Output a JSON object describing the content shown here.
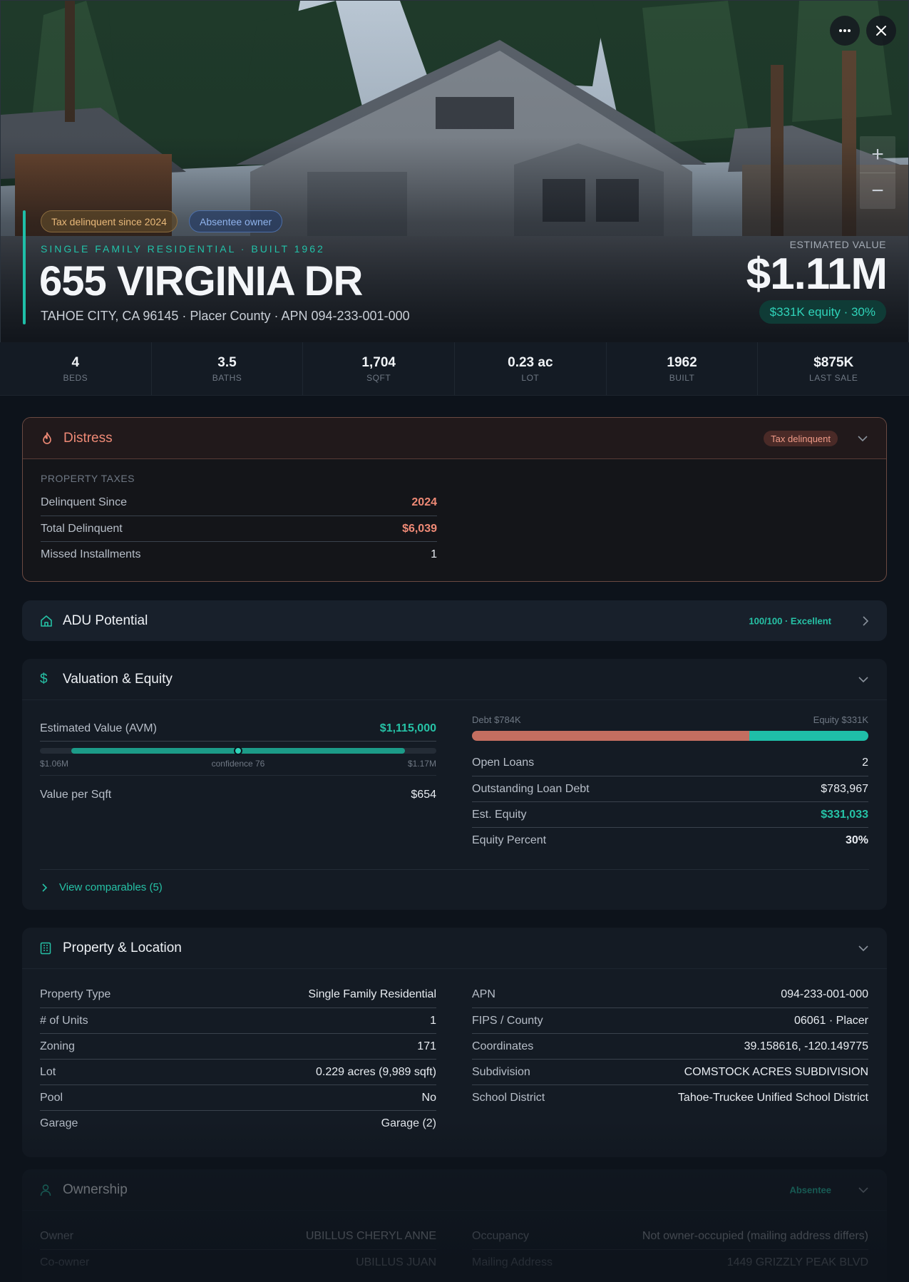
{
  "hero": {
    "badges": {
      "tax": "Tax delinquent since 2024",
      "absentee": "Absentee owner"
    },
    "subtitle": "SINGLE FAMILY RESIDENTIAL · BUILT 1962",
    "address": "655 VIRGINIA DR",
    "location": "TAHOE CITY, CA 96145 · Placer County · APN 094-233-001-000",
    "estimated_label": "ESTIMATED VALUE",
    "estimated_value": "$1.11M",
    "equity_badge": "$331K equity · 30%",
    "zoom_in": "+",
    "zoom_out": "−",
    "icons": {
      "more": "more-dots-icon",
      "close": "close-icon"
    }
  },
  "stats": [
    {
      "value": "4",
      "label": "BEDS"
    },
    {
      "value": "3.5",
      "label": "BATHS"
    },
    {
      "value": "1,704",
      "label": "SQFT"
    },
    {
      "value": "0.23 ac",
      "label": "LOT"
    },
    {
      "value": "1962",
      "label": "BUILT"
    },
    {
      "value": "$875K",
      "label": "LAST SALE"
    }
  ],
  "distress": {
    "title": "Distress",
    "badge": "Tax delinquent",
    "section_label": "PROPERTY TAXES",
    "rows": [
      {
        "label": "Delinquent Since",
        "value": "2024"
      },
      {
        "label": "Total Delinquent",
        "value": "$6,039"
      },
      {
        "label": "Missed Installments",
        "value": "1"
      }
    ]
  },
  "adu": {
    "title": "ADU Potential",
    "score": "100/100 · Excellent"
  },
  "valuation": {
    "title": "Valuation & Equity",
    "avm_label": "Estimated Value (AVM)",
    "avm_value": "$1,115,000",
    "range_low": "$1.06M",
    "range_high": "$1.17M",
    "confidence": "confidence 76",
    "range": {
      "low": 1060000,
      "high": 1170000,
      "estimate": 1115000
    },
    "value_per_sqft_label": "Value per Sqft",
    "value_per_sqft": "$654",
    "debt_label": "Debt $784K",
    "equity_label": "Equity $331K",
    "debt_fraction": 0.7,
    "rows": [
      {
        "label": "Open Loans",
        "value": "2"
      },
      {
        "label": "Outstanding Loan Debt",
        "value": "$783,967"
      },
      {
        "label": "Est. Equity",
        "value": "$331,033"
      },
      {
        "label": "Equity Percent",
        "value": "30%"
      }
    ],
    "comparables_link": "View comparables (5)"
  },
  "location": {
    "title": "Property & Location",
    "left": [
      {
        "label": "Property Type",
        "value": "Single Family Residential"
      },
      {
        "label": "# of Units",
        "value": "1"
      },
      {
        "label": "Zoning",
        "value": "171"
      },
      {
        "label": "Lot",
        "value": "0.229 acres (9,989 sqft)"
      },
      {
        "label": "Pool",
        "value": "No"
      },
      {
        "label": "Garage",
        "value": "Garage (2)"
      }
    ],
    "right": [
      {
        "label": "APN",
        "value": "094-233-001-000"
      },
      {
        "label": "FIPS / County",
        "value": "06061 · Placer"
      },
      {
        "label": "Coordinates",
        "value": "39.158616, -120.149775"
      },
      {
        "label": "Subdivision",
        "value": "COMSTOCK ACRES SUBDIVISION"
      },
      {
        "label": "School District",
        "value": "Tahoe-Truckee Unified School District"
      }
    ]
  },
  "ownership": {
    "title": "Ownership",
    "badge": "Absentee",
    "left": [
      {
        "label": "Owner",
        "value": "UBILLUS CHERYL ANNE"
      },
      {
        "label": "Co-owner",
        "value": "UBILLUS JUAN"
      }
    ],
    "right": [
      {
        "label": "Occupancy",
        "value": "Not owner-occupied (mailing address differs)"
      },
      {
        "label": "Mailing Address",
        "value": "1449 GRIZZLY PEAK BLVD"
      }
    ]
  },
  "colors": {
    "accent": "#1fbfa8",
    "debt": "#c46e60",
    "distress": "#ef8a76",
    "background": "#0d131b"
  }
}
